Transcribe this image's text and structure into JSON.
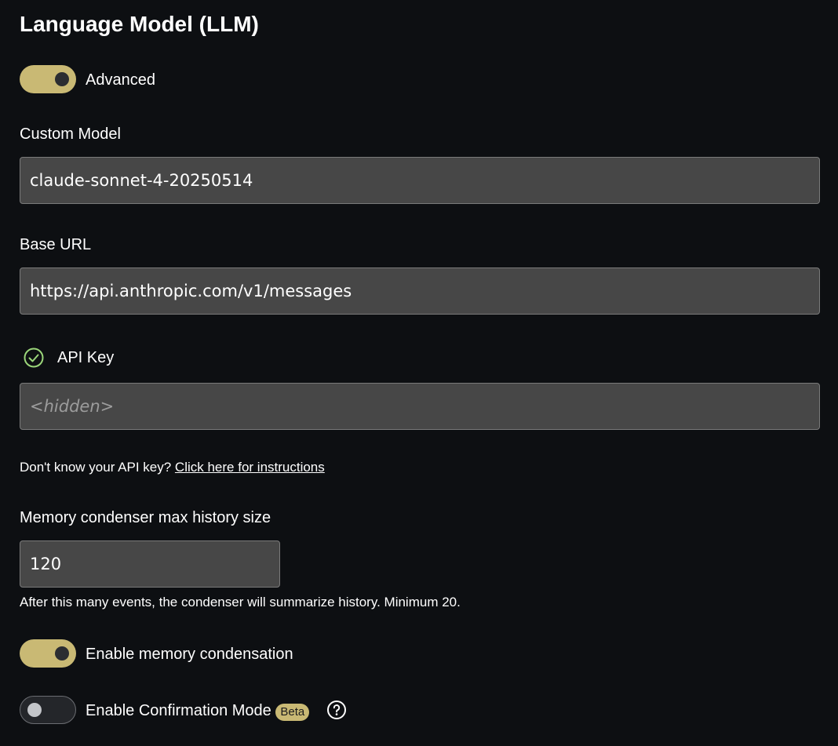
{
  "header": {
    "title": "Language Model (LLM)"
  },
  "advanced_toggle": {
    "label": "Advanced",
    "state": "on"
  },
  "custom_model": {
    "label": "Custom Model",
    "value": "claude-sonnet-4-20250514"
  },
  "base_url": {
    "label": "Base URL",
    "value": "https://api.anthropic.com/v1/messages"
  },
  "api_key": {
    "label": "API Key",
    "status_icon": "check-circle-icon",
    "placeholder": "<hidden>",
    "help_text": "Don't know your API key?",
    "help_link": "Click here for instructions"
  },
  "memory_condenser": {
    "label": "Memory condenser max history size",
    "value": "120",
    "hint": "After this many events, the condenser will summarize history. Minimum 20."
  },
  "enable_memory_condensation": {
    "label": "Enable memory condensation",
    "state": "on"
  },
  "confirmation_mode": {
    "label": "Enable Confirmation Mode",
    "badge": "Beta",
    "state": "off",
    "help_icon": "question-circle-icon"
  },
  "colors": {
    "accent": "#c9b974",
    "background": "#0d0f12",
    "input_bg": "#474747",
    "success": "#9bd67a"
  }
}
